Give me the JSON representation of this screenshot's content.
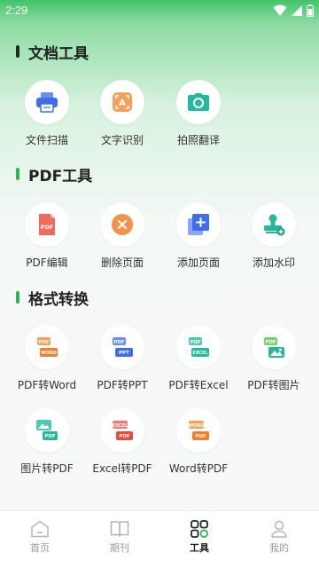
{
  "status": {
    "time": "2:29"
  },
  "sections": {
    "doc": {
      "title": "文档工具",
      "items": [
        {
          "label": "文件扫描",
          "icon": "printer-icon"
        },
        {
          "label": "文字识别",
          "icon": "text-scan-icon"
        },
        {
          "label": "拍照翻译",
          "icon": "camera-icon"
        }
      ]
    },
    "pdf": {
      "title": "PDF工具",
      "items": [
        {
          "label": "PDF编辑",
          "icon": "pdf-file-icon"
        },
        {
          "label": "删除页面",
          "icon": "delete-circle-icon"
        },
        {
          "label": "添加页面",
          "icon": "add-page-icon"
        },
        {
          "label": "添加水印",
          "icon": "stamp-icon"
        }
      ]
    },
    "convert": {
      "title": "格式转换",
      "items": [
        {
          "label": "PDF转Word",
          "icon": "pdf-to-word-icon",
          "top": "PDF",
          "bottom": "WORD"
        },
        {
          "label": "PDF转PPT",
          "icon": "pdf-to-ppt-icon",
          "top": "PDF",
          "bottom": "PPT"
        },
        {
          "label": "PDF转Excel",
          "icon": "pdf-to-excel-icon",
          "top": "PDF",
          "bottom": "EXCEL"
        },
        {
          "label": "PDF转图片",
          "icon": "pdf-to-image-icon",
          "top": "PDF"
        },
        {
          "label": "图片转PDF",
          "icon": "image-to-pdf-icon",
          "bottom": "PDF"
        },
        {
          "label": "Excel转PDF",
          "icon": "excel-to-pdf-icon",
          "top": "EXCEL",
          "bottom": "PDF"
        },
        {
          "label": "Word转PDF",
          "icon": "word-to-pdf-icon",
          "top": "WORD",
          "bottom": "PDF"
        }
      ]
    }
  },
  "tabs": [
    {
      "label": "首页",
      "icon": "home-icon"
    },
    {
      "label": "期刊",
      "icon": "book-icon"
    },
    {
      "label": "工具",
      "icon": "tools-grid-icon",
      "active": true
    },
    {
      "label": "我的",
      "icon": "user-icon"
    }
  ],
  "colors": {
    "accent": "#2cb457",
    "blue": "#3f6ee8",
    "orange": "#f08a3c",
    "teal": "#25b89b",
    "red": "#e8493f"
  }
}
